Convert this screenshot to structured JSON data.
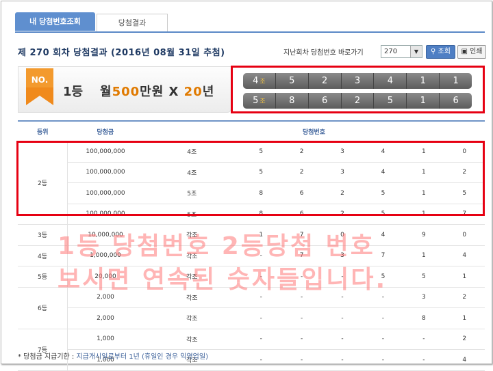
{
  "tabs": [
    {
      "label": "내 당첨번호조회",
      "active": true
    },
    {
      "label": "당첨결과",
      "active": false
    }
  ],
  "header": {
    "title": "제 270 회차 당첨결과 (2016년 08월 31일 추첨)",
    "prev_round_label": "지난회차 당첨번호 바로가기",
    "round_select_value": "270",
    "search_label": "조회",
    "print_label": "인쇄"
  },
  "prize": {
    "badge": "NO.",
    "rank": "1등",
    "desc_prefix": "월",
    "desc_amount": "500",
    "desc_mid": "만원 X ",
    "desc_years": "20",
    "desc_suffix": "년"
  },
  "winning_rows": [
    {
      "group": "4",
      "group_unit": "조",
      "numbers": [
        "5",
        "2",
        "3",
        "4",
        "1",
        "1"
      ]
    },
    {
      "group": "5",
      "group_unit": "조",
      "numbers": [
        "8",
        "6",
        "2",
        "5",
        "1",
        "6"
      ]
    }
  ],
  "table": {
    "headers": [
      "등위",
      "당첨금",
      "당첨번호"
    ],
    "rows": [
      {
        "rank": "2등",
        "rankspan": 4,
        "amount": "100,000,000",
        "group": "4조",
        "nums": [
          "5",
          "2",
          "3",
          "4",
          "1",
          "0"
        ]
      },
      {
        "rank": null,
        "amount": "100,000,000",
        "group": "4조",
        "nums": [
          "5",
          "2",
          "3",
          "4",
          "1",
          "2"
        ]
      },
      {
        "rank": null,
        "amount": "100,000,000",
        "group": "5조",
        "nums": [
          "8",
          "6",
          "2",
          "5",
          "1",
          "5"
        ]
      },
      {
        "rank": null,
        "amount": "100,000,000",
        "group": "5조",
        "nums": [
          "8",
          "6",
          "2",
          "5",
          "1",
          "7"
        ]
      },
      {
        "rank": "3등",
        "rankspan": 1,
        "amount": "10,000,000",
        "group": "각조",
        "nums": [
          "1",
          "7",
          "0",
          "4",
          "9",
          "0"
        ]
      },
      {
        "rank": "4등",
        "rankspan": 1,
        "amount": "1,000,000",
        "group": "각조",
        "nums": [
          "-",
          "7",
          "3",
          "7",
          "1",
          "4"
        ]
      },
      {
        "rank": "5등",
        "rankspan": 1,
        "amount": "20,000",
        "group": "각조",
        "nums": [
          "-",
          "-",
          "-",
          "5",
          "5",
          "1"
        ]
      },
      {
        "rank": "6등",
        "rankspan": 2,
        "amount": "2,000",
        "group": "각조",
        "nums": [
          "-",
          "-",
          "-",
          "-",
          "3",
          "2"
        ]
      },
      {
        "rank": null,
        "amount": "2,000",
        "group": "각조",
        "nums": [
          "-",
          "-",
          "-",
          "-",
          "8",
          "1"
        ]
      },
      {
        "rank": "7등",
        "rankspan": 2,
        "amount": "1,000",
        "group": "각조",
        "nums": [
          "-",
          "-",
          "-",
          "-",
          "-",
          "2"
        ]
      },
      {
        "rank": null,
        "amount": "1,000",
        "group": "각조",
        "nums": [
          "-",
          "-",
          "-",
          "-",
          "-",
          "4"
        ]
      }
    ]
  },
  "overlay": {
    "line1": "1등 당첨번호 2등당첨 번호",
    "line2": "보시면 연속된 숫자들입니다."
  },
  "footnote": {
    "label": "* 당첨금 지급기한 : ",
    "text": "지급개시일로부터 1년 (휴일인 경우 익영업일)"
  },
  "colors": {
    "accent": "#5f8fcf",
    "highlight": "#e07a00",
    "annotation_red": "#e60012"
  }
}
